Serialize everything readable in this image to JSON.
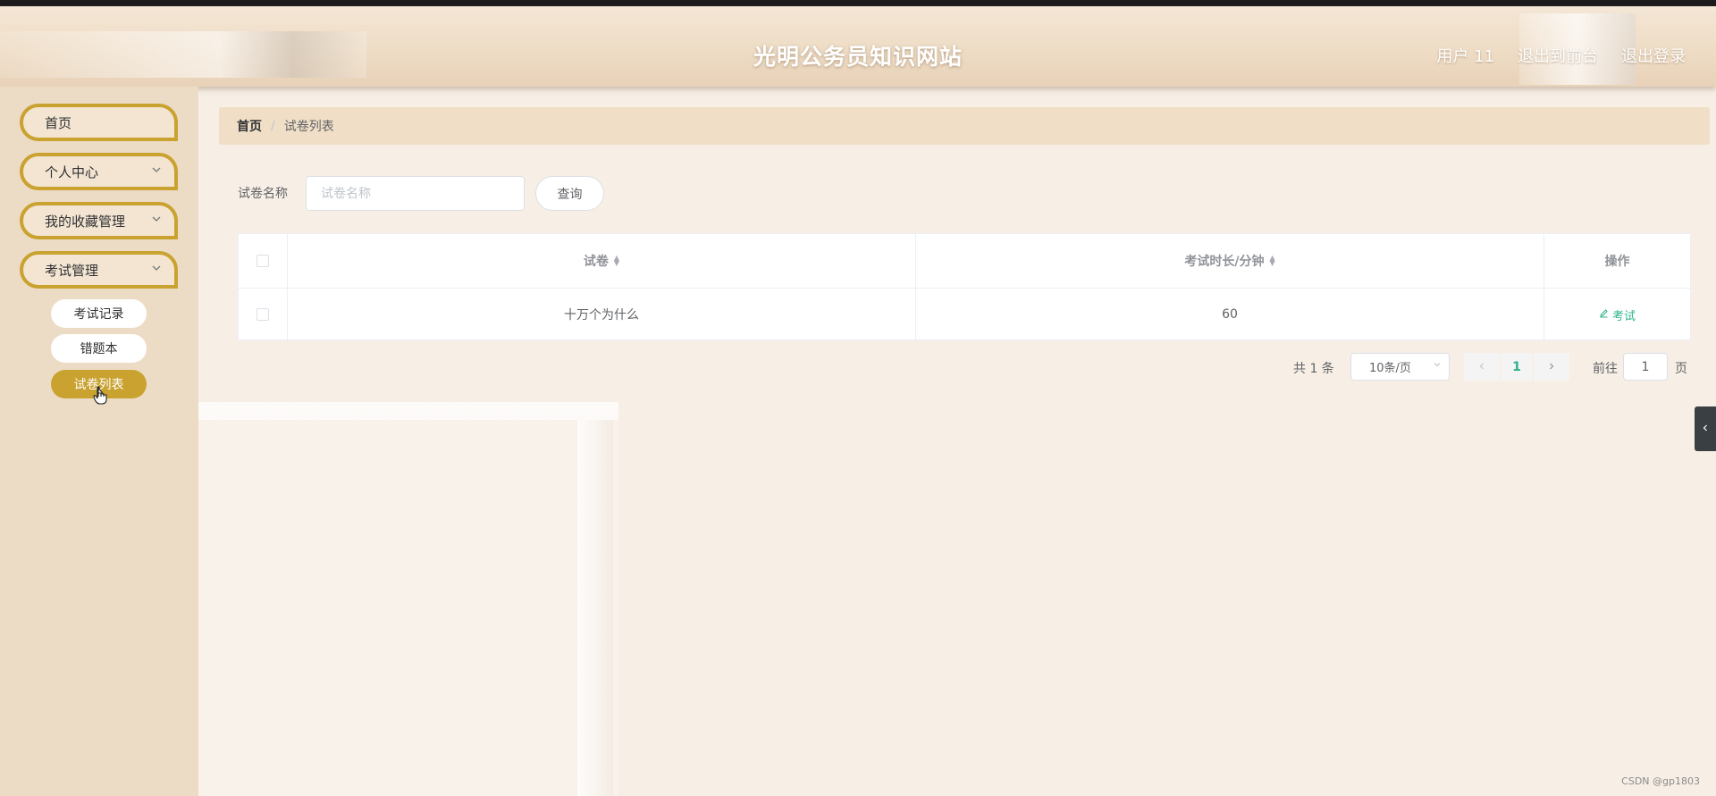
{
  "header": {
    "title": "光明公务员知识网站",
    "links": [
      "用户 11",
      "退出到前台",
      "退出登录"
    ]
  },
  "sidebar": {
    "items": [
      {
        "label": "首页"
      },
      {
        "label": "个人中心"
      },
      {
        "label": "我的收藏管理"
      },
      {
        "label": "考试管理"
      }
    ],
    "subitems": [
      "考试记录",
      "错题本",
      "试卷列表"
    ],
    "active_subitem": "试卷列表"
  },
  "breadcrumb": {
    "home": "首页",
    "separator": "/",
    "current": "试卷列表"
  },
  "search": {
    "label": "试卷名称",
    "placeholder": "试卷名称",
    "button": "查询"
  },
  "table": {
    "columns": [
      "试卷",
      "考试时长/分钟",
      "操作"
    ],
    "rows": [
      {
        "name": "十万个为什么",
        "duration": "60",
        "action": "考试"
      }
    ]
  },
  "pagination": {
    "total": "共 1 条",
    "page_size": "10条/页",
    "current_page": "1",
    "goto_label": "前往",
    "goto_value": "1",
    "page_suffix": "页"
  },
  "watermark": "CSDN @gp1803",
  "colors": {
    "accent": "#c9a230",
    "link": "#2bb38a",
    "sidebar_bg": "#ecdcc5",
    "breadcrumb_bg": "#f0dfc6"
  }
}
